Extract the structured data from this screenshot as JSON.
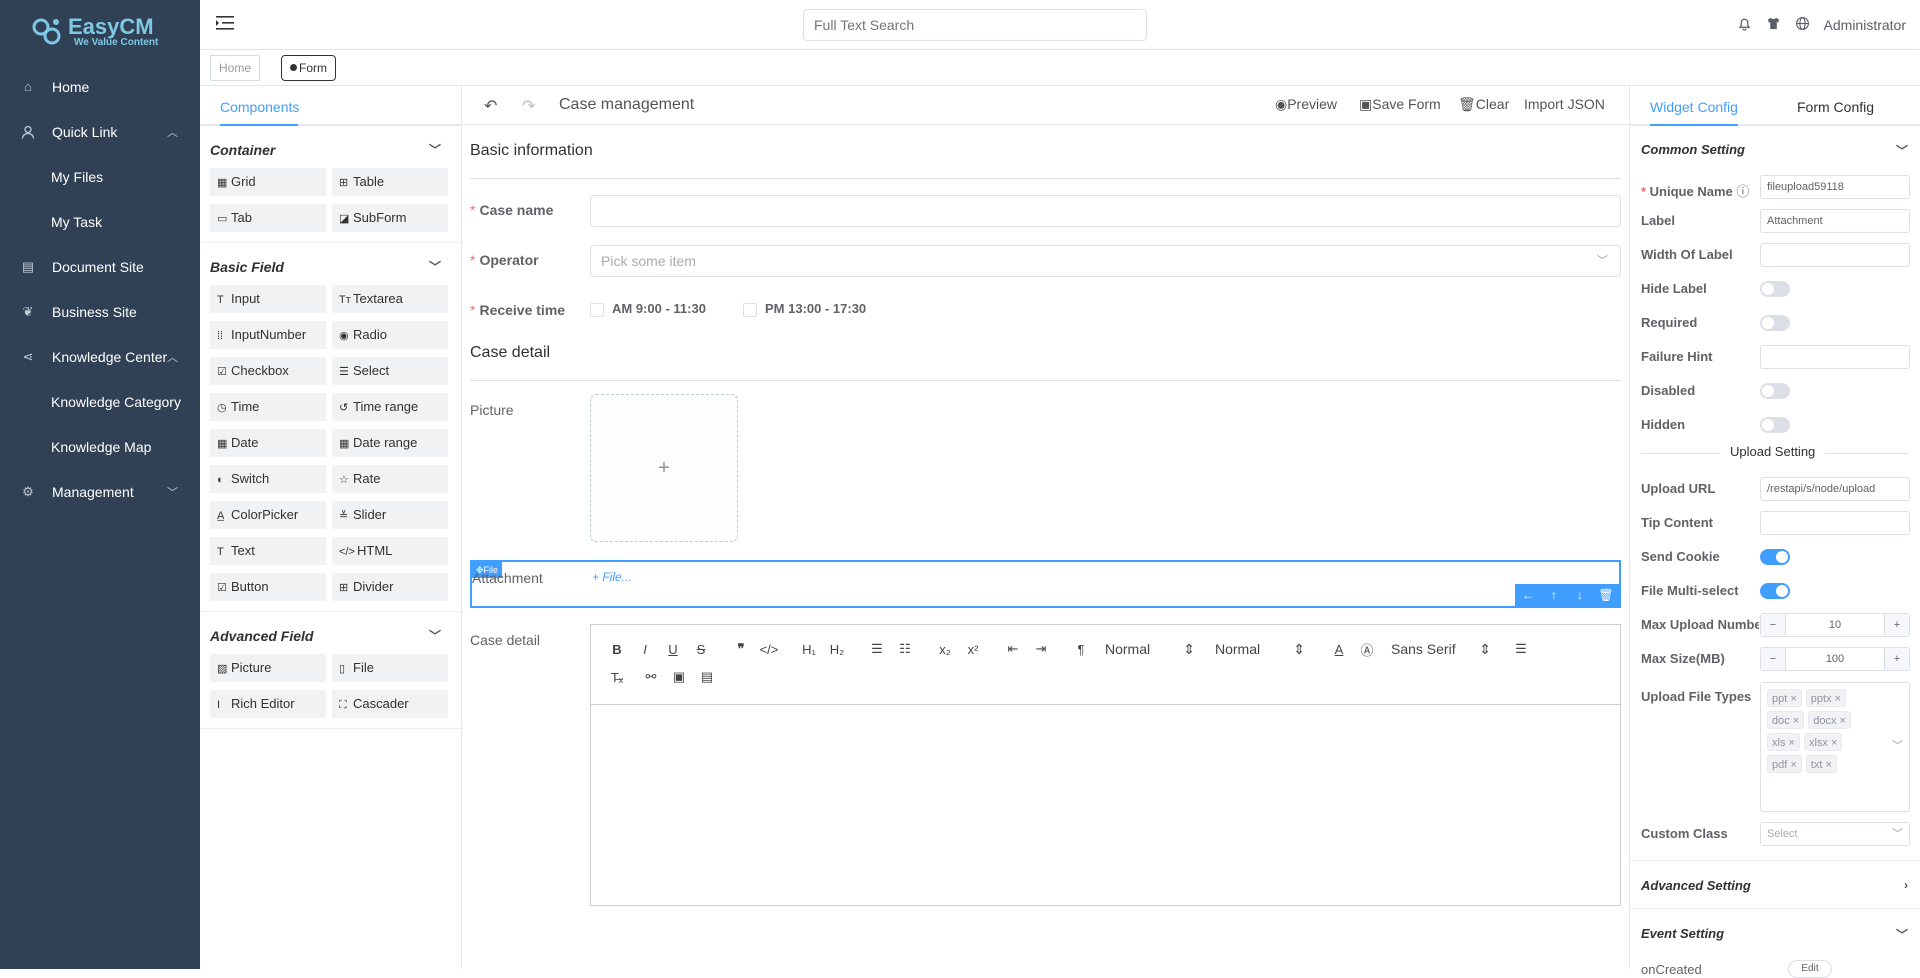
{
  "app": {
    "logo_title": "EasyCM",
    "logo_tagline": "We Value Content",
    "accent": "#409eff",
    "sidebar_bg": "#304156"
  },
  "sidebar": {
    "items": [
      {
        "label": "Home",
        "icon": "home-icon"
      },
      {
        "label": "Quick Link",
        "icon": "user-icon"
      },
      {
        "label": "My Files"
      },
      {
        "label": "My Task"
      },
      {
        "label": "Document Site",
        "icon": "document-icon"
      },
      {
        "label": "Business Site",
        "icon": "leaf-icon"
      },
      {
        "label": "Knowledge Center",
        "icon": "share-icon"
      },
      {
        "label": "Knowledge Category"
      },
      {
        "label": "Knowledge Map"
      },
      {
        "label": "Management",
        "icon": "gear-icon"
      }
    ]
  },
  "topbar": {
    "search_placeholder": "Full Text Search",
    "user": "Administrator"
  },
  "tags": {
    "home": "Home",
    "form": "Form"
  },
  "components": {
    "tab": "Components",
    "container": {
      "title": "Container",
      "items": [
        "Grid",
        "Table",
        "Tab",
        "SubForm"
      ]
    },
    "basic": {
      "title": "Basic Field",
      "items": [
        "Input",
        "Textarea",
        "InputNumber",
        "Radio",
        "Checkbox",
        "Select",
        "Time",
        "Time range",
        "Date",
        "Date range",
        "Switch",
        "Rate",
        "ColorPicker",
        "Slider",
        "Text",
        "HTML",
        "Button",
        "Divider"
      ]
    },
    "advanced": {
      "title": "Advanced Field",
      "items": [
        "Picture",
        "File",
        "Rich Editor",
        "Cascader"
      ]
    }
  },
  "toolbar": {
    "title": "Case management",
    "preview": "Preview",
    "save": "Save Form",
    "clear": "Clear",
    "import": "Import JSON"
  },
  "form": {
    "section1": "Basic information",
    "case_name_label": "Case name",
    "operator_label": "Operator",
    "operator_placeholder": "Pick some item",
    "receive_label": "Receive time",
    "receive_opt1": "AM 9:00 - 11:30",
    "receive_opt2": "PM 13:00 - 17:30",
    "section2": "Case detail",
    "picture_label": "Picture",
    "attachment_label": "Attachment",
    "attachment_btn": "File...",
    "drag_tag": "File",
    "detail_label": "Case detail",
    "rte_header1": "Normal",
    "rte_header2": "Normal",
    "rte_font": "Sans Serif"
  },
  "config": {
    "tab_widget": "Widget Config",
    "tab_form": "Form Config",
    "common": "Common Setting",
    "unique_name_label": "Unique Name",
    "unique_name": "fileupload59118",
    "label_label": "Label",
    "label_value": "Attachment",
    "width_label": "Width Of Label",
    "hide_label": "Hide Label",
    "required": "Required",
    "failure_hint": "Failure Hint",
    "disabled": "Disabled",
    "hidden": "Hidden",
    "upload_setting": "Upload Setting",
    "upload_url_label": "Upload URL",
    "upload_url": "/restapi/s/node/upload",
    "tip_content": "Tip Content",
    "send_cookie": "Send Cookie",
    "multi_select": "File Multi-select",
    "max_number_label": "Max Upload Numbe",
    "max_number": "10",
    "max_size_label": "Max Size(MB)",
    "max_size": "100",
    "file_types_label": "Upload File Types",
    "file_types": [
      "ppt",
      "pptx",
      "doc",
      "docx",
      "xls",
      "xlsx",
      "pdf",
      "txt"
    ],
    "custom_class": "Custom Class",
    "custom_class_placeholder": "Select",
    "advanced": "Advanced Setting",
    "event": "Event Setting",
    "on_created": "onCreated",
    "edit": "Edit"
  }
}
